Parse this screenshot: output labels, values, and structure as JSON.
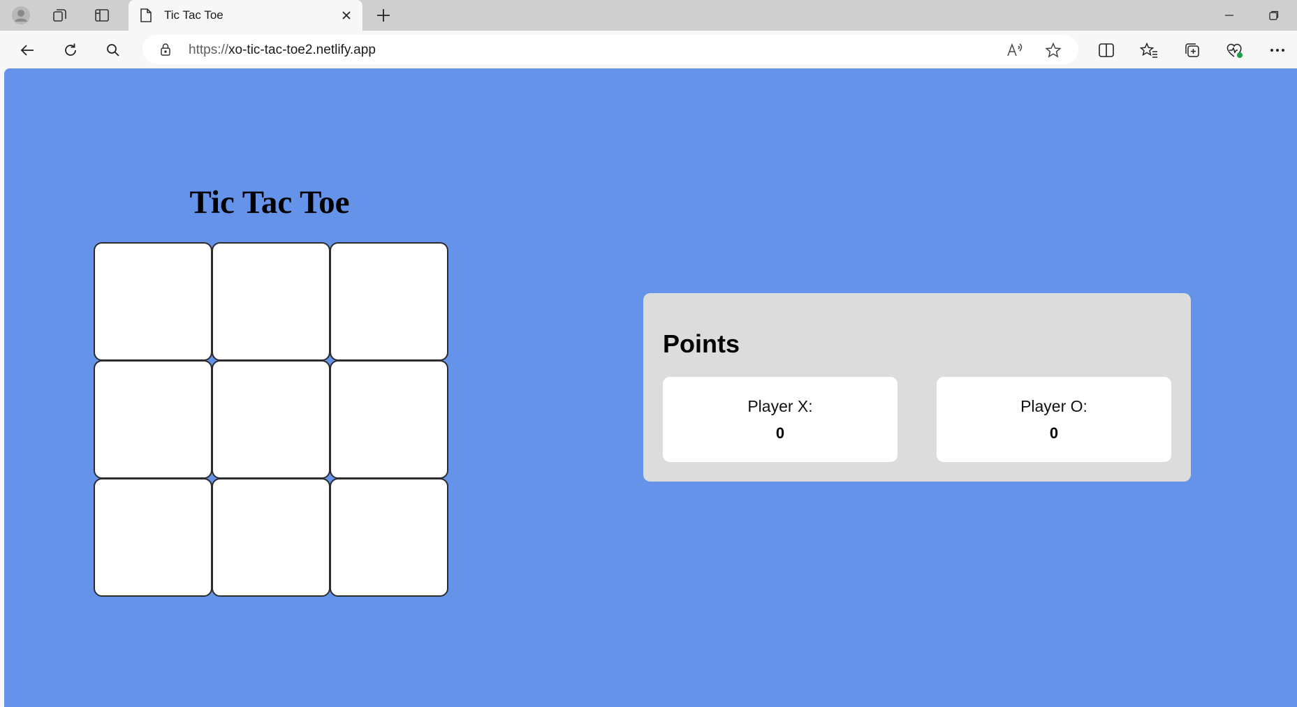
{
  "browser": {
    "tab": {
      "title": "Tic Tac Toe"
    },
    "address": {
      "protocol": "https://",
      "host": "xo-tic-tac-toe2.netlify.app"
    }
  },
  "page": {
    "title": "Tic Tac Toe",
    "board": {
      "cells": [
        "",
        "",
        "",
        "",
        "",
        "",
        "",
        "",
        ""
      ]
    },
    "points": {
      "title": "Points",
      "player_x": {
        "label": "Player X:",
        "score": "0"
      },
      "player_o": {
        "label": "Player O:",
        "score": "0"
      }
    }
  },
  "colors": {
    "page_background": "#6593ea",
    "panel_background": "#dcdcdc",
    "card_background": "#ffffff"
  }
}
